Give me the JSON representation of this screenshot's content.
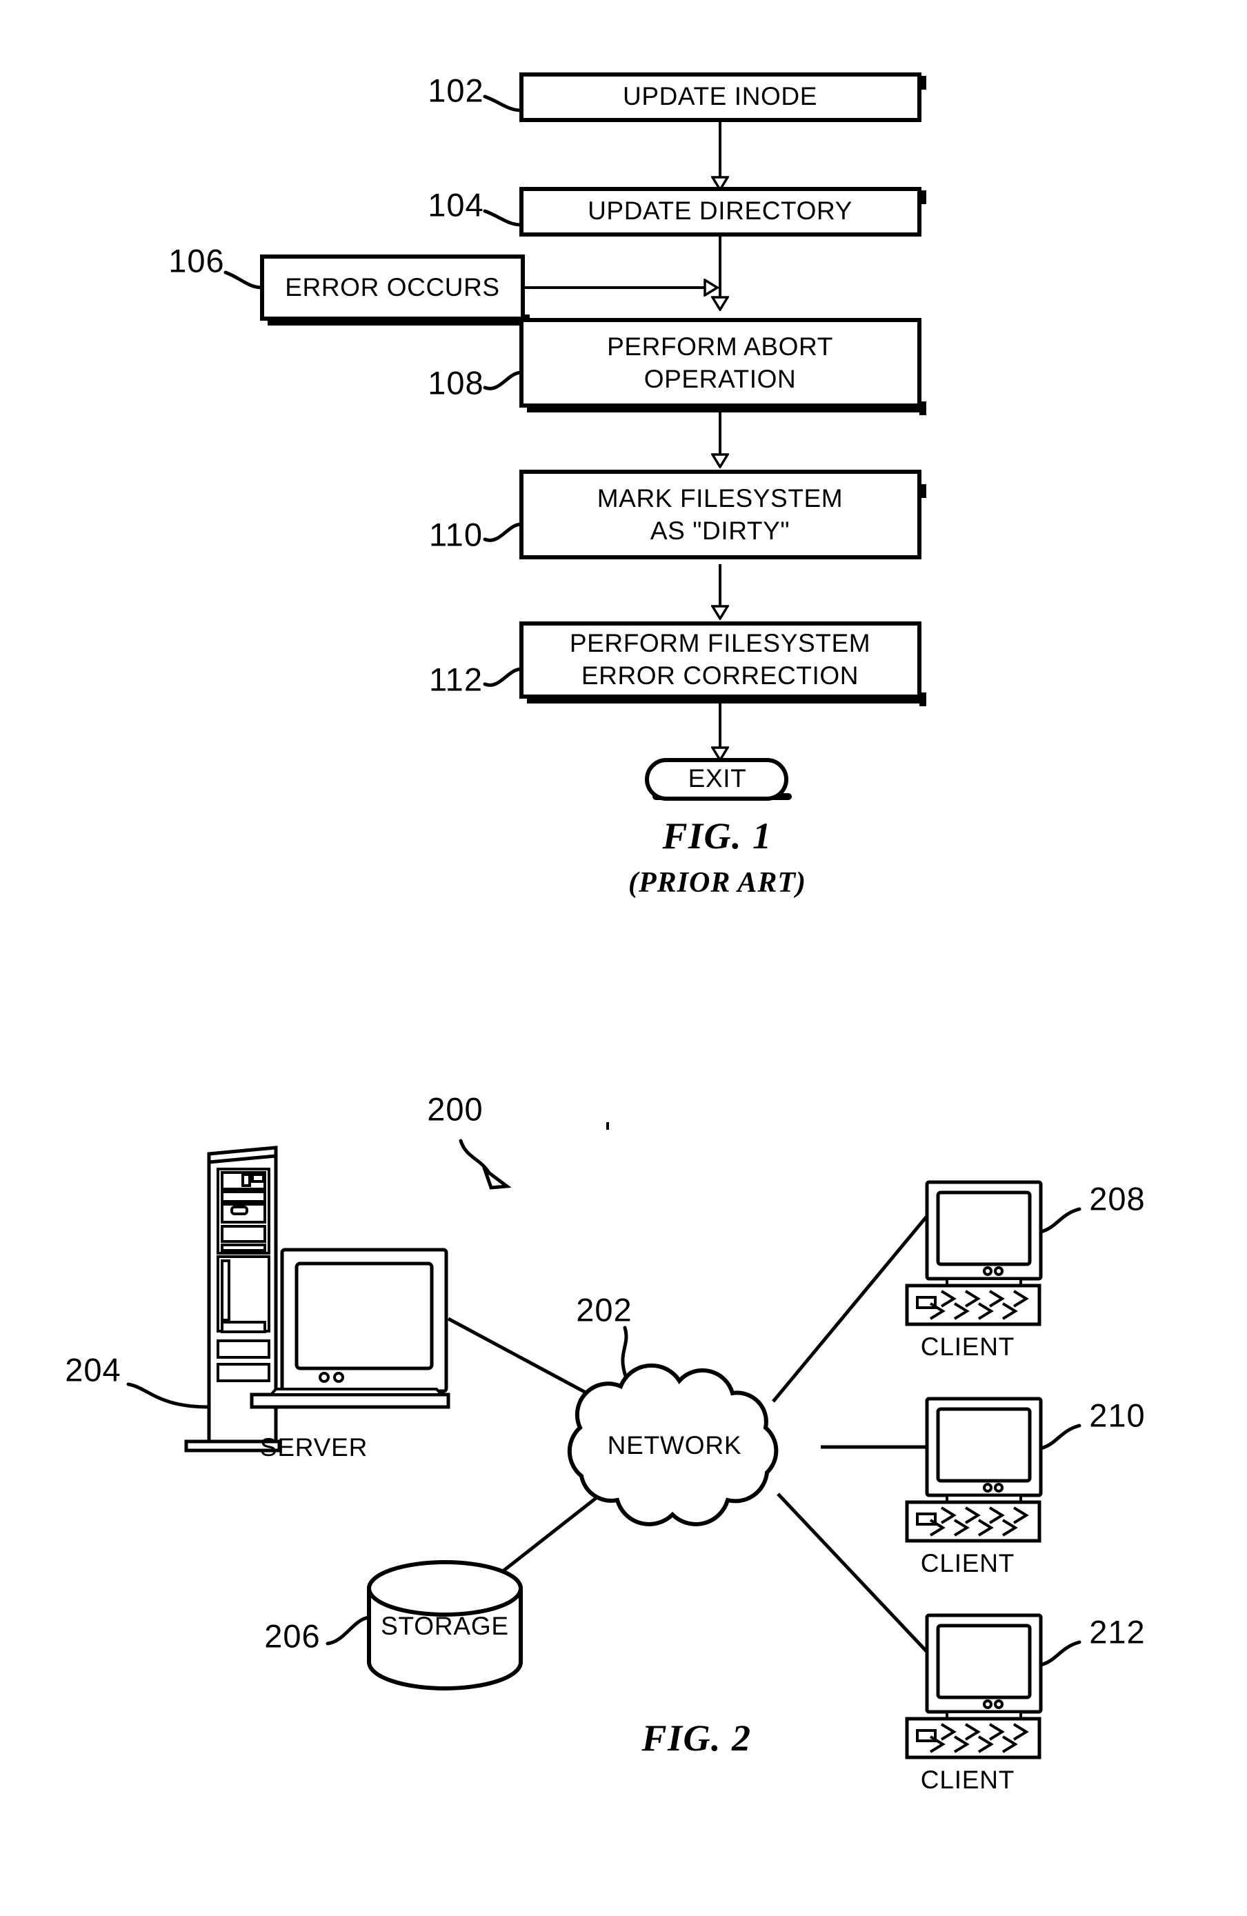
{
  "document": {
    "type": "patent-figure-sheet",
    "figures": [
      "FIG. 1",
      "FIG. 2"
    ]
  },
  "figure1": {
    "caption": "FIG. 1",
    "subcaption": "(PRIOR ART)",
    "type": "flowchart",
    "steps": [
      {
        "ref": "102",
        "label": "UPDATE INODE",
        "lines": [
          "UPDATE INODE"
        ],
        "shape": "rect"
      },
      {
        "ref": "104",
        "label": "UPDATE DIRECTORY",
        "lines": [
          "UPDATE DIRECTORY"
        ],
        "shape": "rect"
      },
      {
        "ref": "106",
        "label": "ERROR OCCURS",
        "lines": [
          "ERROR OCCURS"
        ],
        "shape": "rect"
      },
      {
        "ref": "108",
        "label": "PERFORM ABORT OPERATION",
        "lines": [
          "PERFORM ABORT",
          "OPERATION"
        ],
        "shape": "rect"
      },
      {
        "ref": "110",
        "label": "MARK FILESYSTEM AS \"DIRTY\"",
        "lines": [
          "MARK FILESYSTEM",
          "AS \"DIRTY\""
        ],
        "shape": "rect"
      },
      {
        "ref": "112",
        "label": "PERFORM FILESYSTEM ERROR CORRECTION",
        "lines": [
          "PERFORM FILESYSTEM",
          "ERROR CORRECTION"
        ],
        "shape": "rect"
      },
      {
        "ref": "",
        "label": "EXIT",
        "lines": [
          "EXIT"
        ],
        "shape": "terminator"
      }
    ],
    "flow": [
      {
        "from": "102",
        "to": "104",
        "kind": "vertical-arrow"
      },
      {
        "from": "104",
        "to": "108",
        "kind": "vertical-arrow"
      },
      {
        "from": "106",
        "to": "104-108-link",
        "kind": "horizontal-arrow"
      },
      {
        "from": "108",
        "to": "110",
        "kind": "vertical-arrow"
      },
      {
        "from": "110",
        "to": "112",
        "kind": "vertical-arrow"
      },
      {
        "from": "112",
        "to": "EXIT",
        "kind": "vertical-arrow"
      }
    ]
  },
  "figure2": {
    "caption": "FIG. 2",
    "type": "network-diagram",
    "system_ref": "200",
    "nodes": [
      {
        "ref": "204",
        "label": "SERVER",
        "kind": "server-tower-and-monitor"
      },
      {
        "ref": "202",
        "label": "NETWORK",
        "kind": "cloud"
      },
      {
        "ref": "206",
        "label": "STORAGE",
        "kind": "cylinder"
      },
      {
        "ref": "208",
        "label": "CLIENT",
        "kind": "desktop-computer"
      },
      {
        "ref": "210",
        "label": "CLIENT",
        "kind": "desktop-computer"
      },
      {
        "ref": "212",
        "label": "CLIENT",
        "kind": "desktop-computer"
      }
    ],
    "links": [
      {
        "from": "204",
        "to": "202"
      },
      {
        "from": "206",
        "to": "202"
      },
      {
        "from": "202",
        "to": "208"
      },
      {
        "from": "202",
        "to": "210"
      },
      {
        "from": "202",
        "to": "212"
      }
    ]
  },
  "colors": {
    "ink": "#000000",
    "paper": "#ffffff"
  }
}
